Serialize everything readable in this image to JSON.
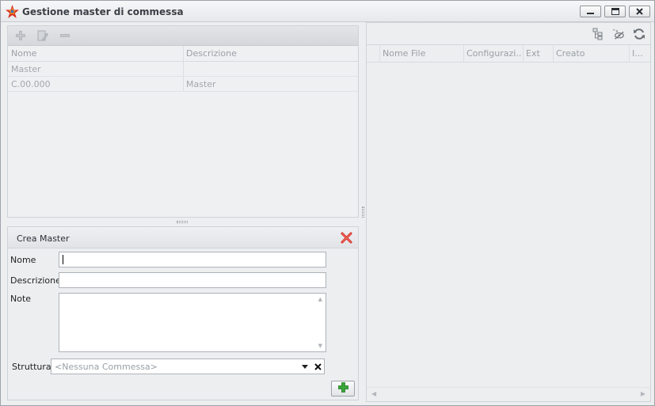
{
  "window": {
    "title": "Gestione master di commessa",
    "buttons": [
      "minimize-icon",
      "maximize-icon",
      "close-icon"
    ]
  },
  "master_toolbar": {
    "icons": [
      "add-icon",
      "edit-icon",
      "remove-icon"
    ]
  },
  "master_grid": {
    "columns": [
      "Nome",
      "Descrizione"
    ],
    "rows": [
      [
        "Master",
        ""
      ],
      [
        "C.00.000",
        "Master"
      ]
    ]
  },
  "crea_master": {
    "title": "Crea Master",
    "nome_label": "Nome",
    "nome_value": "",
    "descrizione_label": "Descrizione",
    "descrizione_value": "",
    "note_label": "Note",
    "note_value": "",
    "struttura_label": "Struttura",
    "struttura_placeholder": "<Nessuna Commessa>"
  },
  "files_toolbar": {
    "icons": [
      "tree-icon",
      "hide-icon",
      "refresh-icon"
    ]
  },
  "files_grid": {
    "columns": [
      "Nome File",
      "Configurazi...",
      "Ext",
      "Creato",
      "I..."
    ]
  },
  "colors": {
    "accent_red": "#d7261c",
    "accent_green": "#3aa53a"
  }
}
